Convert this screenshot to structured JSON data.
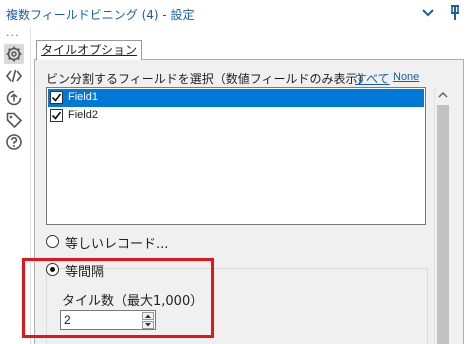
{
  "header": {
    "title": "複数フィールドビニング (4) - 設定",
    "collapse_icon": "chevron-down-icon",
    "pin_icon": "pin-icon",
    "title_color": "#1a5ea8"
  },
  "sidebar": {
    "more": "...",
    "icons": [
      "settings-gear-icon",
      "code-icon",
      "annotation-icon",
      "tag-icon",
      "help-icon"
    ]
  },
  "tab": {
    "label": "タイルオプション"
  },
  "field_selector": {
    "label": "ビン分割するフィールドを選択（数値フィールドのみ表示）",
    "select_all": "すべて",
    "select_none": "None",
    "items": [
      {
        "label": "Field1",
        "checked": true,
        "selected": true
      },
      {
        "label": "Field2",
        "checked": true,
        "selected": false
      }
    ]
  },
  "options": {
    "equal_records": "等しいレコード...",
    "equal_interval": "等間隔",
    "selected": "equal_interval"
  },
  "tiles": {
    "label": "タイル数（最大1,000）",
    "value": "2"
  },
  "colors": {
    "selection": "#0078d7",
    "highlight_box": "#e0161e",
    "link": "#1a5ea8"
  }
}
